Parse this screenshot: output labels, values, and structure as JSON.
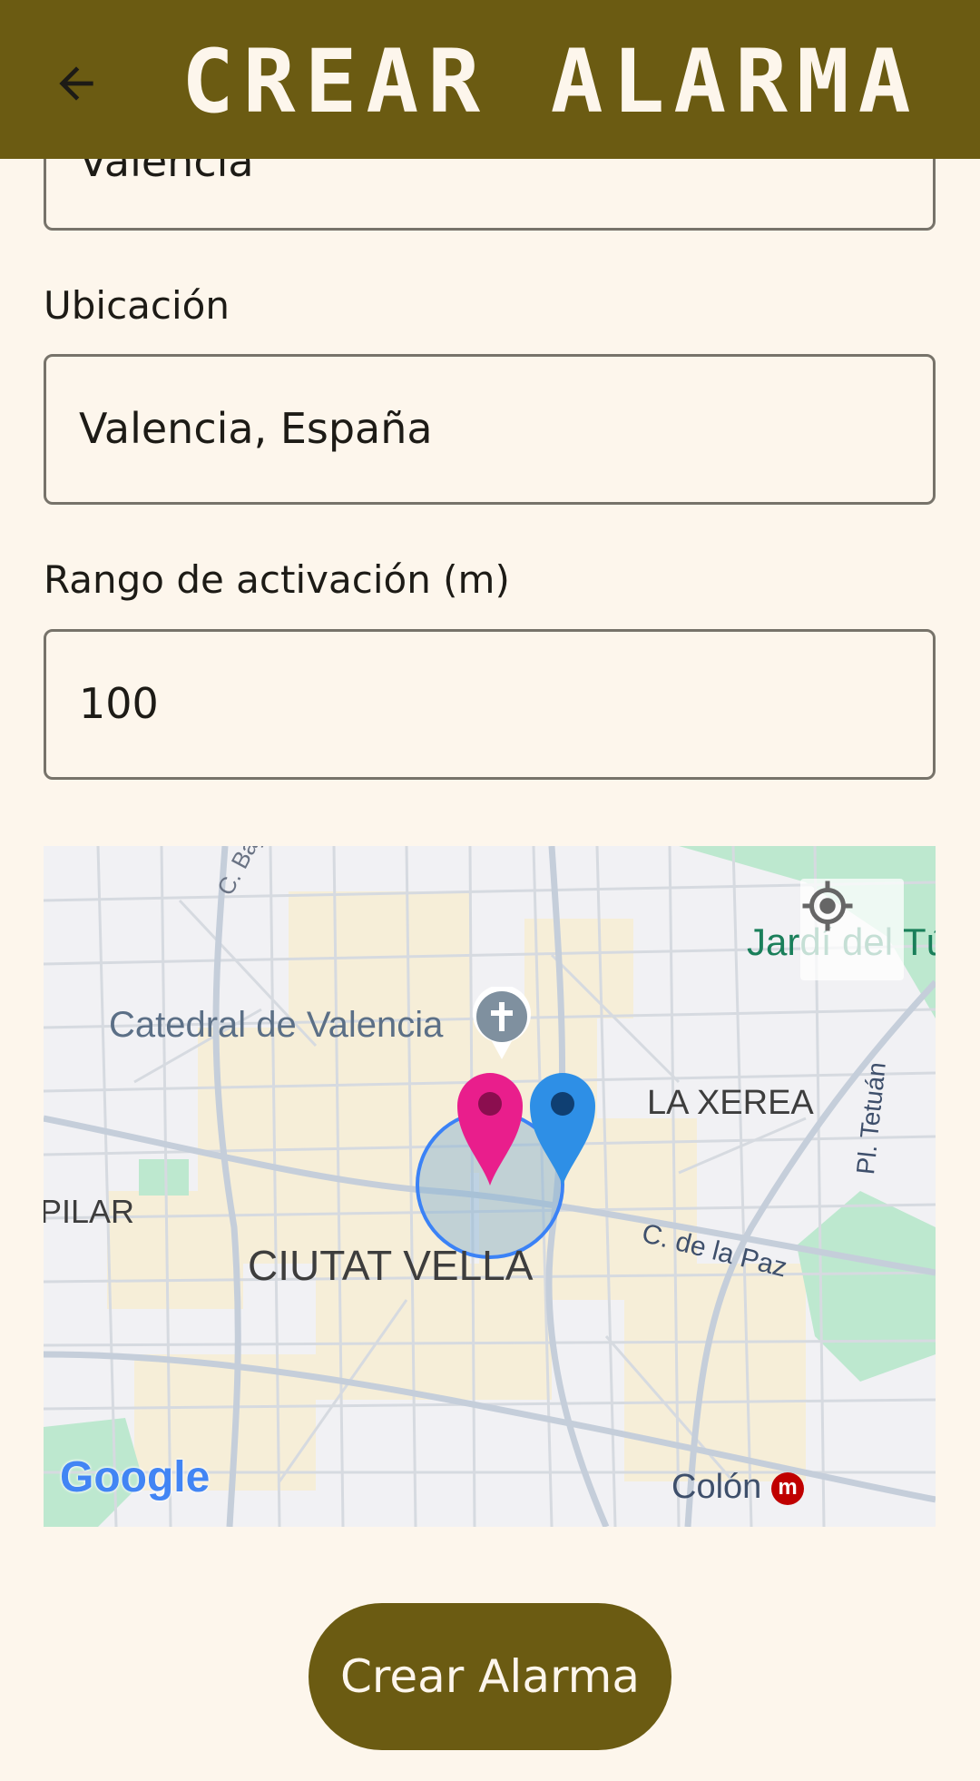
{
  "appbar": {
    "title": "CREAR ALARMA",
    "back_icon": "arrow-left-icon"
  },
  "fields": {
    "name_value": "Valencia",
    "location_label": "Ubicación",
    "location_value": "Valencia, España",
    "range_label": "Rango de activación (m)",
    "range_value": "100"
  },
  "map": {
    "labels": {
      "catedral": "Catedral de Valencia",
      "la_xerea": "LA XEREA",
      "ciutat_vella": "CIUTAT VELLA",
      "pilar": "PILAR",
      "c_baja": "C. Baja",
      "c_paz": "C. de la Paz",
      "pl_tetuan": "Pl. Tetuán",
      "jardi": "Jardí del Túria",
      "colon": "Colón",
      "metro": "m"
    },
    "attribution": "Google",
    "locate_icon": "my-location-icon",
    "colors": {
      "pink_marker": "#E91E8C",
      "blue_marker": "#2E8FE6",
      "radius": "#3B82F6"
    }
  },
  "actions": {
    "create_label": "Crear Alarma"
  }
}
